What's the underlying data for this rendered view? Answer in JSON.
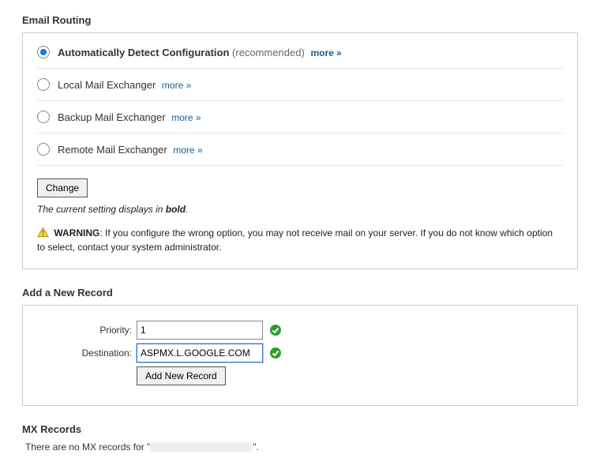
{
  "sections": {
    "routing_title": "Email Routing",
    "add_record_title": "Add a New Record",
    "mx_records_title": "MX Records"
  },
  "routing": {
    "options": [
      {
        "label": "Automatically Detect Configuration",
        "suffix": "(recommended)",
        "more": "more »"
      },
      {
        "label": "Local Mail Exchanger",
        "suffix": "",
        "more": "more »"
      },
      {
        "label": "Backup Mail Exchanger",
        "suffix": "",
        "more": "more »"
      },
      {
        "label": "Remote Mail Exchanger",
        "suffix": "",
        "more": "more »"
      }
    ],
    "change_button": "Change",
    "hint_prefix": "The current setting displays in ",
    "hint_bold": "bold",
    "hint_suffix": ".",
    "warning_label": "WARNING",
    "warning_text": ": If you configure the wrong option, you may not receive mail on your server. If you do not know which option to select, contact your system administrator."
  },
  "add_record": {
    "priority_label": "Priority:",
    "priority_value": "1",
    "destination_label": "Destination:",
    "destination_value": "ASPMX.L.GOOGLE.COM",
    "add_button": "Add New Record"
  },
  "mx": {
    "none_prefix": "There are no MX records for \"",
    "none_suffix": "\"."
  }
}
